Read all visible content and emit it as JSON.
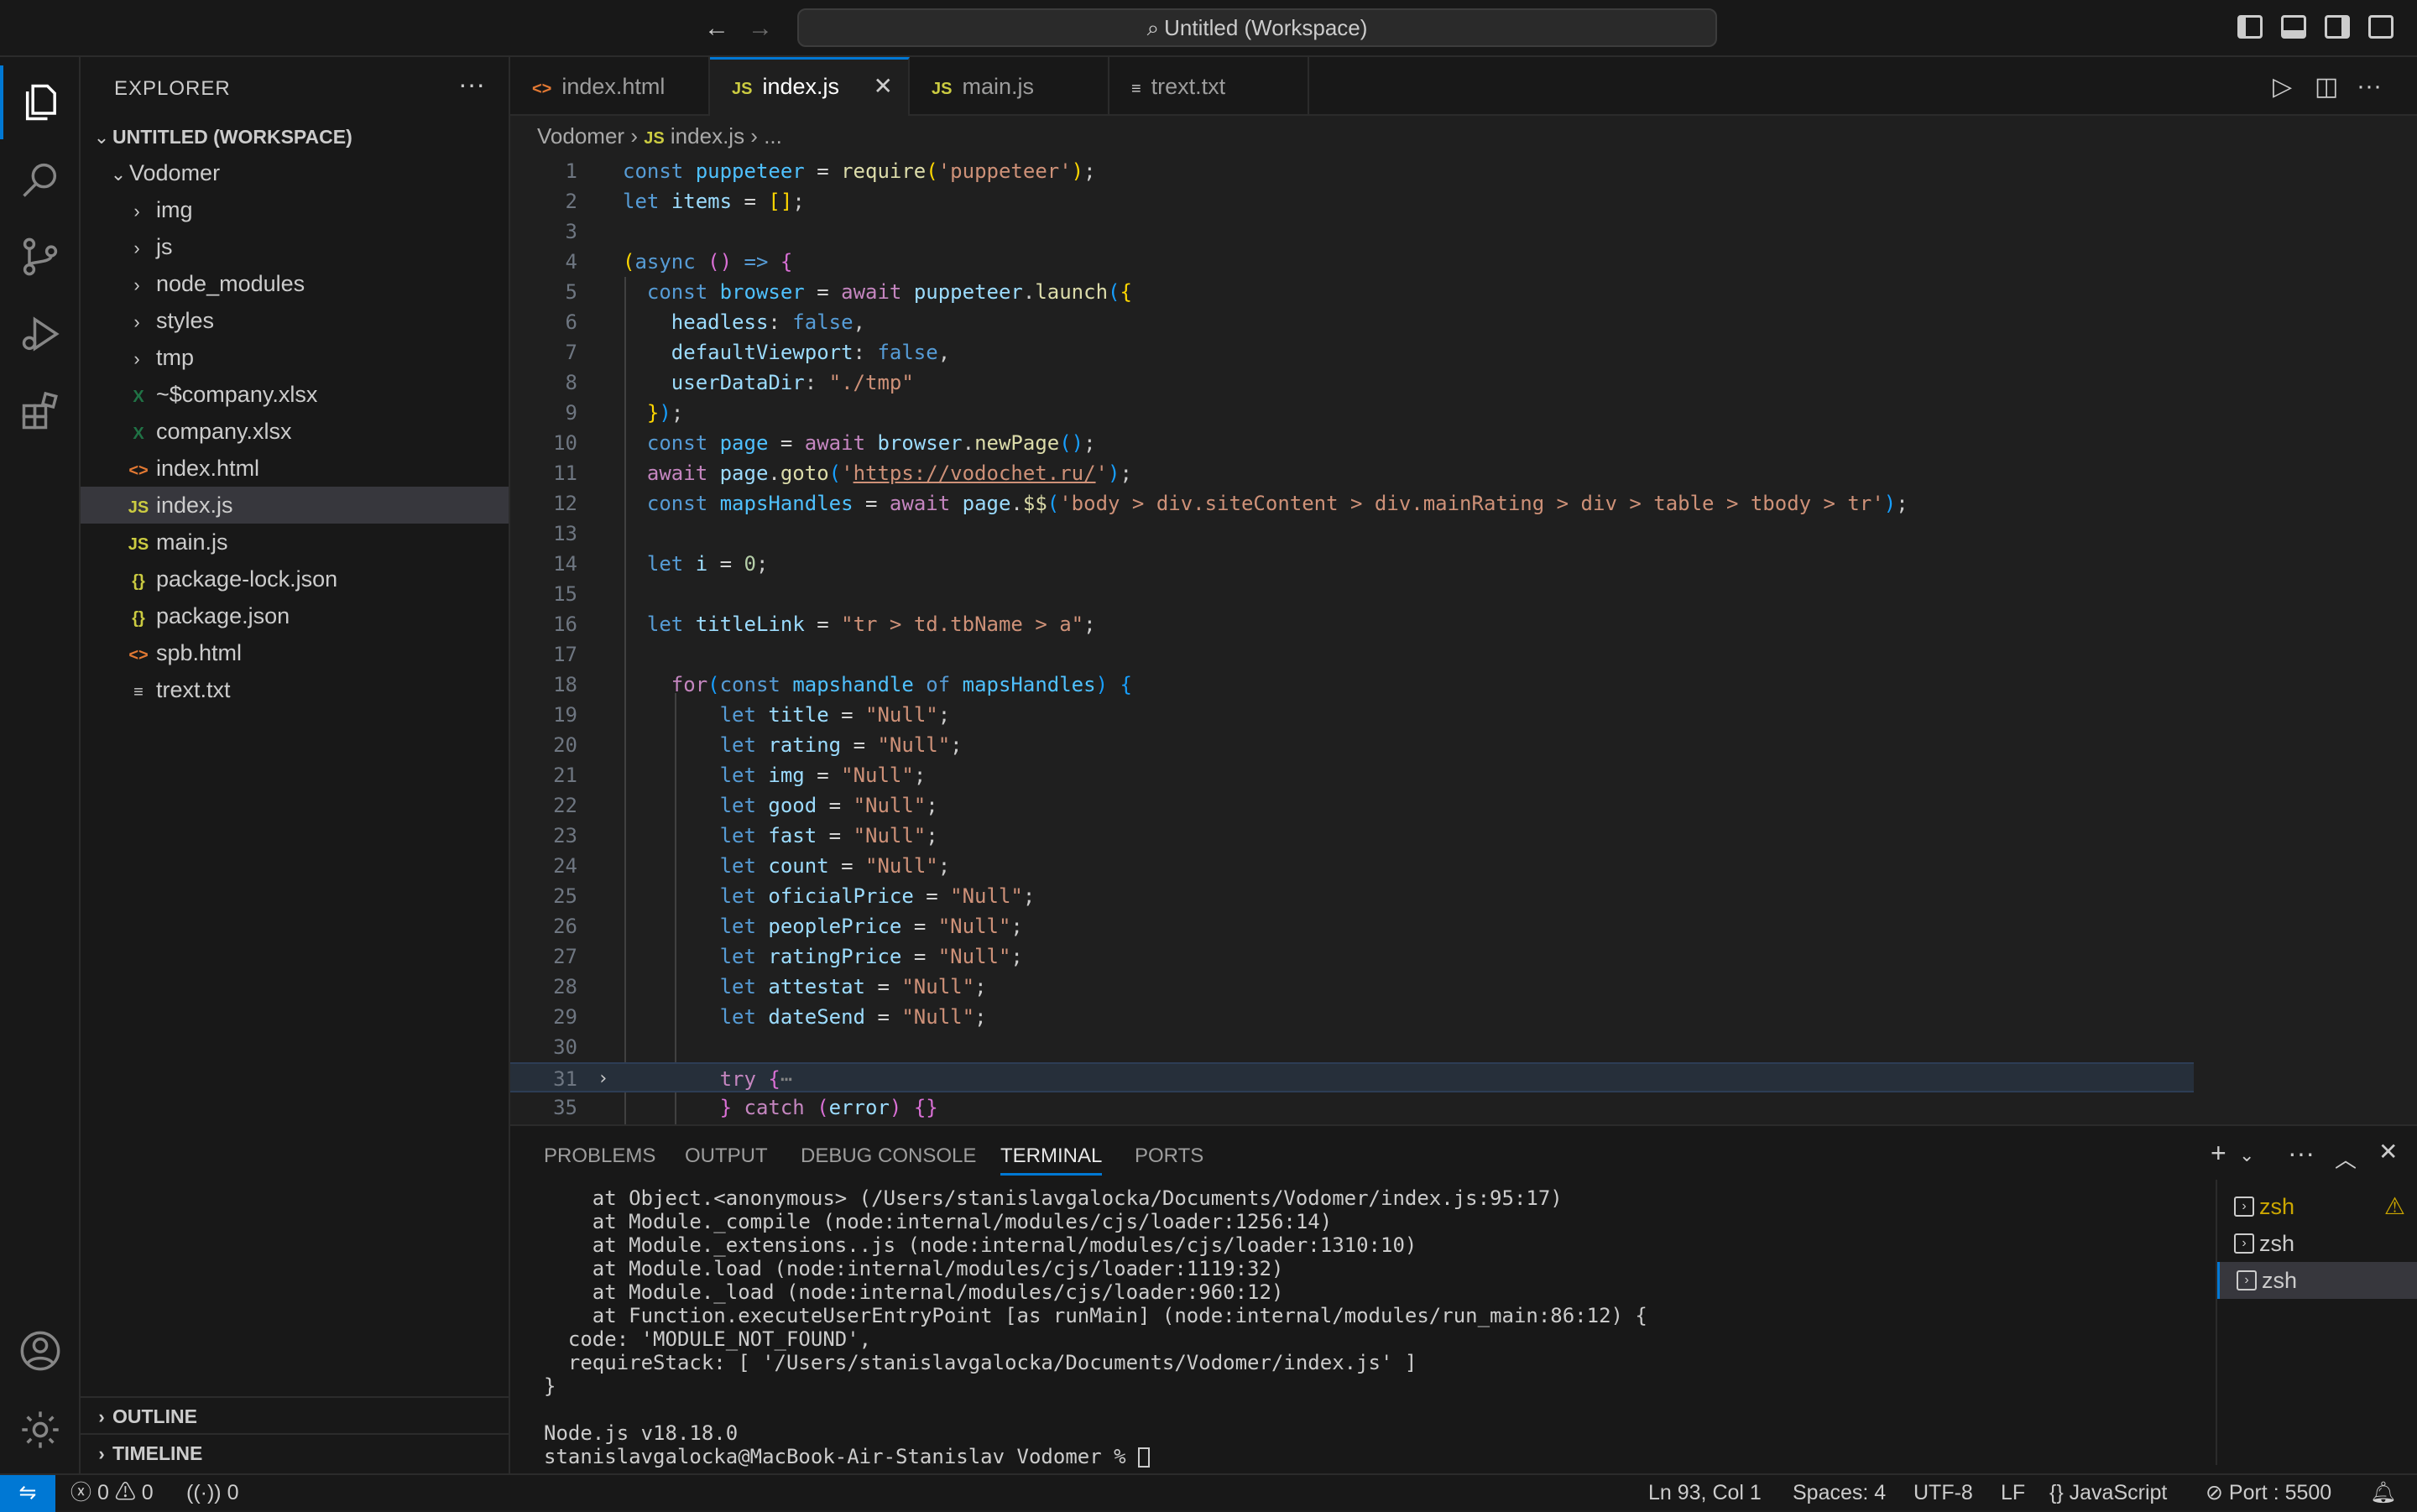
{
  "titlebar": {
    "command_center": "Untitled (Workspace)"
  },
  "activitybar": {
    "items": [
      "explorer-icon",
      "search-icon",
      "source-control-icon",
      "run-debug-icon",
      "extensions-icon",
      "account-icon",
      "settings-gear-icon"
    ]
  },
  "sidebar": {
    "title": "EXPLORER",
    "more": "···",
    "workspace": "UNTITLED (WORKSPACE)",
    "folder": "Vodomer",
    "items": [
      {
        "label": "img",
        "type": "folder"
      },
      {
        "label": "js",
        "type": "folder"
      },
      {
        "label": "node_modules",
        "type": "folder"
      },
      {
        "label": "styles",
        "type": "folder"
      },
      {
        "label": "tmp",
        "type": "folder"
      },
      {
        "label": "~$company.xlsx",
        "type": "xlsx"
      },
      {
        "label": "company.xlsx",
        "type": "xlsx"
      },
      {
        "label": "index.html",
        "type": "html"
      },
      {
        "label": "index.js",
        "type": "js"
      },
      {
        "label": "main.js",
        "type": "js"
      },
      {
        "label": "package-lock.json",
        "type": "json"
      },
      {
        "label": "package.json",
        "type": "json"
      },
      {
        "label": "spb.html",
        "type": "html"
      },
      {
        "label": "trext.txt",
        "type": "txt"
      }
    ],
    "outline": "OUTLINE",
    "timeline": "TIMELINE"
  },
  "tabs": [
    {
      "label": "index.html",
      "icon": "<>"
    },
    {
      "label": "index.js",
      "icon": "JS"
    },
    {
      "label": "main.js",
      "icon": "JS"
    },
    {
      "label": "trext.txt",
      "icon": "≡"
    }
  ],
  "breadcrumb": {
    "folder": "Vodomer",
    "file_icon": "JS",
    "file": "index.js",
    "symbol": "..."
  },
  "editor": {
    "line_numbers": [
      "1",
      "2",
      "3",
      "4",
      "5",
      "6",
      "7",
      "8",
      "9",
      "10",
      "11",
      "12",
      "13",
      "14",
      "15",
      "16",
      "17",
      "18",
      "19",
      "20",
      "21",
      "22",
      "23",
      "24",
      "25",
      "26",
      "27",
      "28",
      "29",
      "30",
      "31",
      "35"
    ]
  },
  "panel": {
    "tabs": [
      "PROBLEMS",
      "OUTPUT",
      "DEBUG CONSOLE",
      "TERMINAL",
      "PORTS"
    ],
    "terminal_lines": [
      "    at Object.<anonymous> (/Users/stanislavgalocka/Documents/Vodomer/index.js:95:17)",
      "    at Module._compile (node:internal/modules/cjs/loader:1256:14)",
      "    at Module._extensions..js (node:internal/modules/cjs/loader:1310:10)",
      "    at Module.load (node:internal/modules/cjs/loader:1119:32)",
      "    at Module._load (node:internal/modules/cjs/loader:960:12)",
      "    at Function.executeUserEntryPoint [as runMain] (node:internal/modules/run_main:86:12) {",
      "  code: 'MODULE_NOT_FOUND',",
      "  requireStack: [ '/Users/stanislavgalocka/Documents/Vodomer/index.js' ]",
      "}",
      "",
      "Node.js v18.18.0",
      "stanislavgalocka@MacBook-Air-Stanislav Vodomer % "
    ],
    "terminals": [
      "zsh",
      "zsh",
      "zsh"
    ]
  },
  "statusbar": {
    "errors": "0",
    "warnings": "0",
    "ports_forwarded": "0",
    "position": "Ln 93, Col 1",
    "spaces": "Spaces: 4",
    "encoding": "UTF-8",
    "eol": "LF",
    "language": "JavaScript",
    "port": "Port : 5500"
  },
  "colors": {
    "accent": "#0078d4",
    "background": "#1f1f1f",
    "sidebar": "#181818"
  }
}
